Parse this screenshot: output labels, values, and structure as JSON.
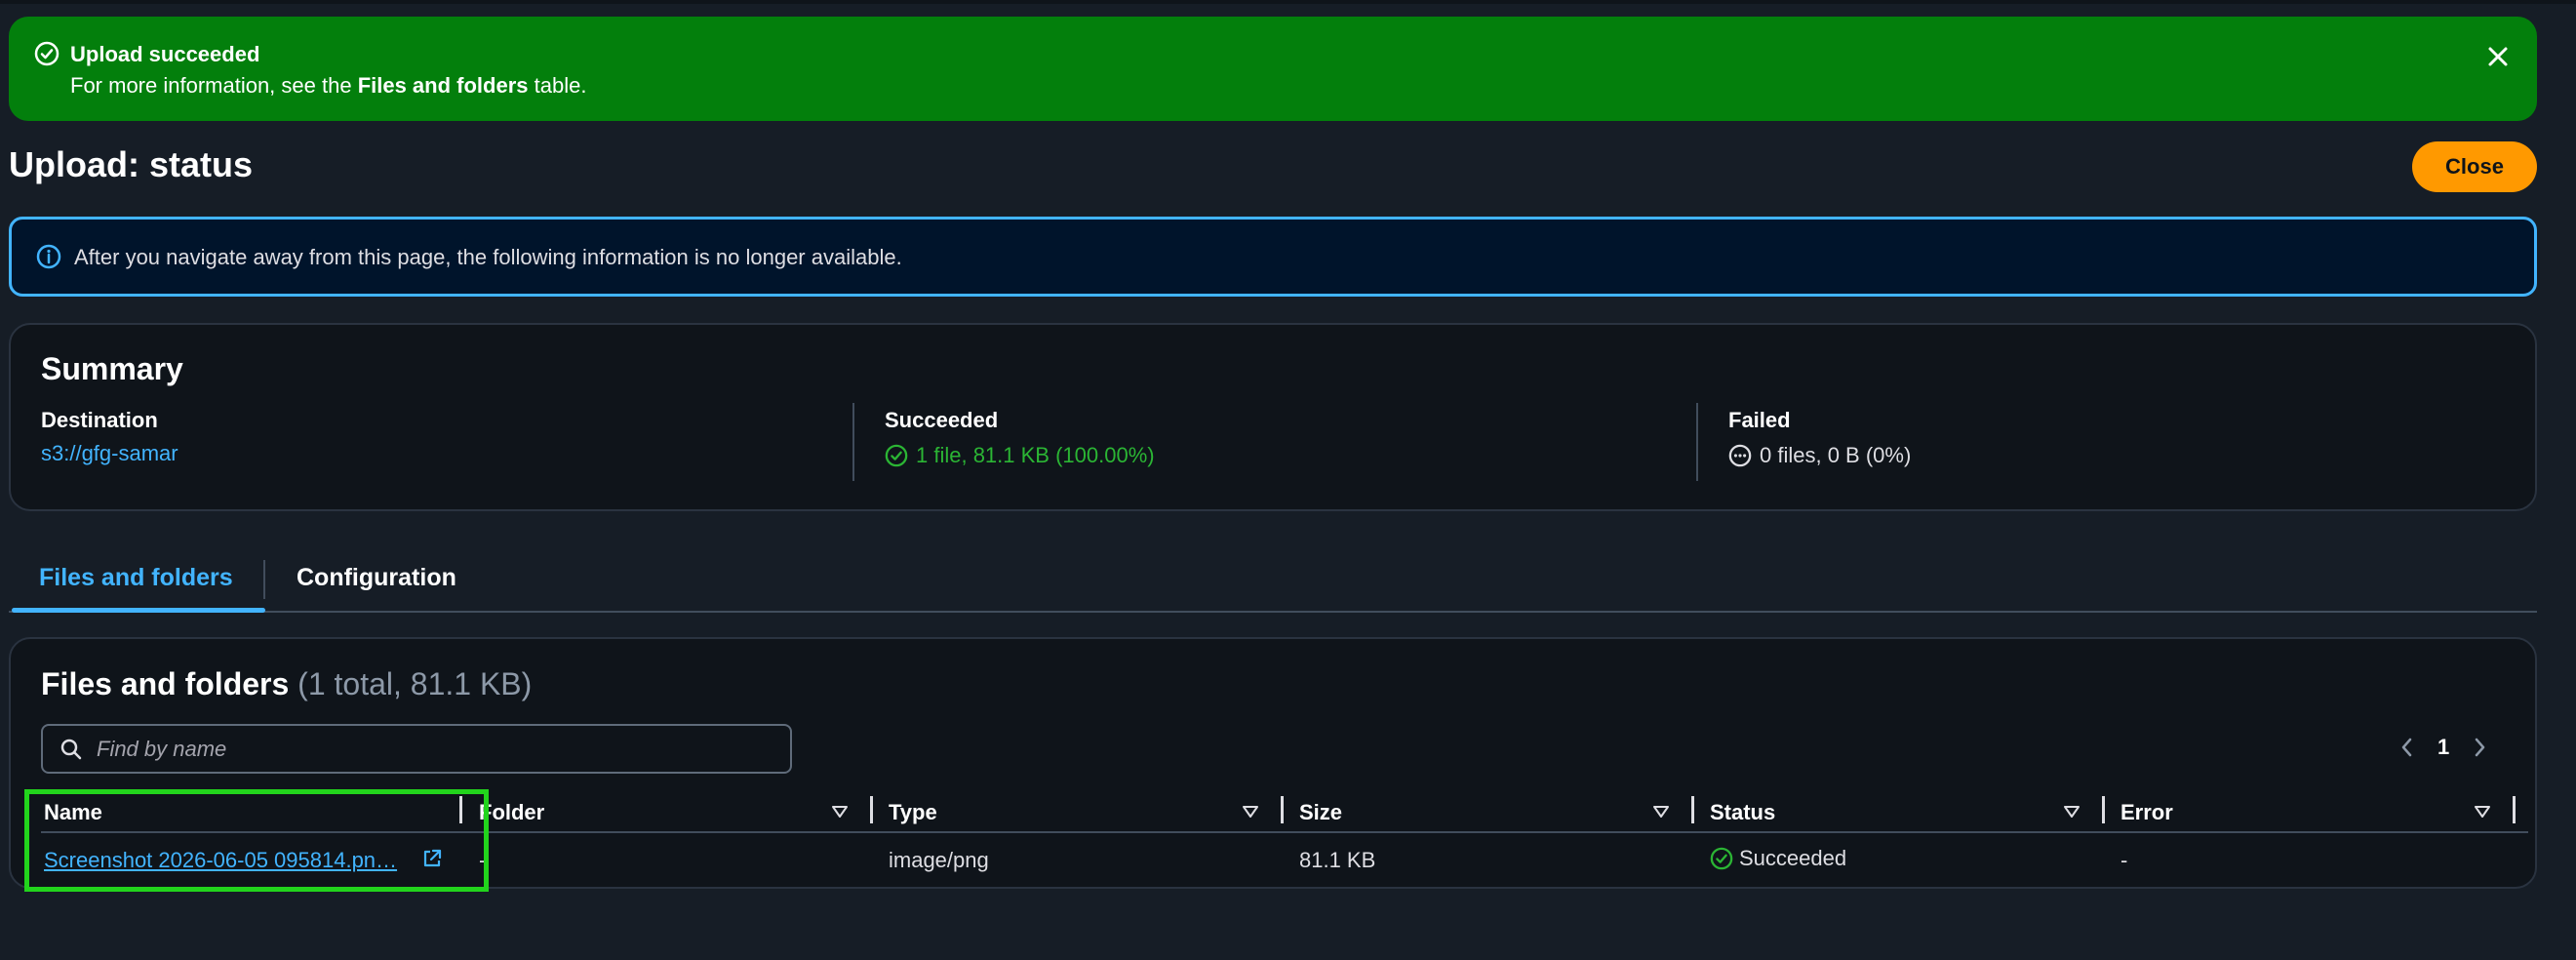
{
  "flash": {
    "title": "Upload succeeded",
    "desc_prefix": "For more information, see the ",
    "desc_bold": "Files and folders",
    "desc_suffix": " table."
  },
  "header": {
    "title": "Upload: status",
    "close_label": "Close"
  },
  "info": {
    "text": "After you navigate away from this page, the following information is no longer available."
  },
  "summary": {
    "title": "Summary",
    "destination_label": "Destination",
    "destination_value": "s3://gfg-samar",
    "succeeded_label": "Succeeded",
    "succeeded_value": "1 file, 81.1 KB (100.00%)",
    "failed_label": "Failed",
    "failed_value": "0 files, 0 B (0%)"
  },
  "tabs": {
    "files": "Files and folders",
    "config": "Configuration"
  },
  "files": {
    "title": "Files and folders",
    "count": "(1 total, 81.1 KB)",
    "search_placeholder": "Find by name",
    "page": "1",
    "columns": [
      "Name",
      "Folder",
      "Type",
      "Size",
      "Status",
      "Error"
    ],
    "rows": [
      {
        "name": "Screenshot 2026-06-05 095814.pn…",
        "folder": "-",
        "type": "image/png",
        "size": "81.1 KB",
        "status": "Succeeded",
        "error": "-"
      }
    ]
  },
  "colors": {
    "success_banner": "#037f0c",
    "accent_blue": "#42b4ff",
    "primary_button": "#ff9900",
    "success_text": "#2bb534",
    "highlight_box": "#22d41c"
  }
}
